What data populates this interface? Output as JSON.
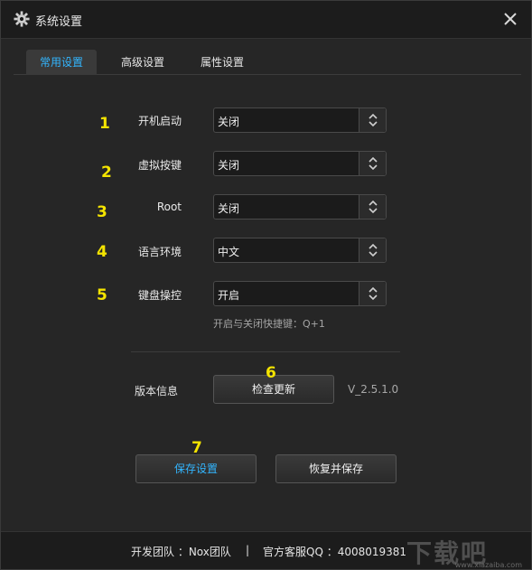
{
  "window": {
    "title": "系统设置"
  },
  "tabs": [
    {
      "label": "常用设置",
      "active": true
    },
    {
      "label": "高级设置",
      "active": false
    },
    {
      "label": "属性设置",
      "active": false
    }
  ],
  "settings": [
    {
      "marker": "1",
      "label": "开机启动",
      "value": "关闭"
    },
    {
      "marker": "2",
      "label": "虚拟按键",
      "value": "关闭"
    },
    {
      "marker": "3",
      "label": "Root",
      "value": "关闭"
    },
    {
      "marker": "4",
      "label": "语言环境",
      "value": "中文"
    },
    {
      "marker": "5",
      "label": "键盘操控",
      "value": "开启"
    }
  ],
  "hint": "开启与关闭快捷键：Q+1",
  "version": {
    "label": "版本信息",
    "check_button": "检查更新",
    "marker": "6",
    "value": "V_2.5.1.0"
  },
  "actions": {
    "marker": "7",
    "save": "保存设置",
    "restore": "恢复并保存"
  },
  "footer": {
    "team": "开发团队 ：Nox团队",
    "separator": "|",
    "qq": "官方客服QQ ：4008019381"
  },
  "watermark": {
    "text": "下载吧",
    "url": "www.xiazaiba.com"
  },
  "colors": {
    "accent": "#33b6ff",
    "marker": "#f4e400"
  }
}
